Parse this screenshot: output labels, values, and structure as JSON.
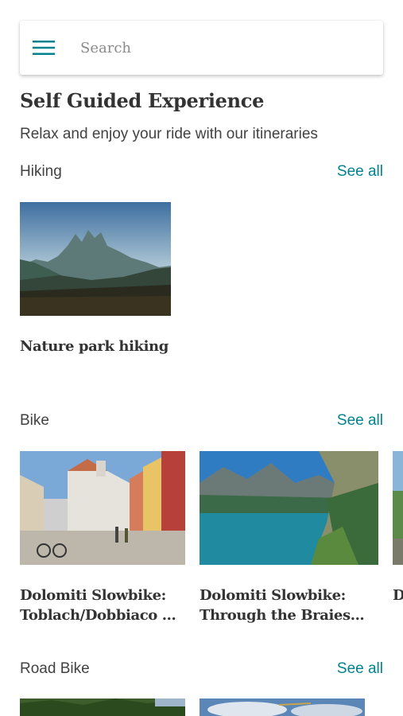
{
  "search": {
    "placeholder": "Search"
  },
  "header": {
    "title": "Self Guided Experience",
    "subtitle": "Relax and enjoy your ride with our itineraries"
  },
  "sections": [
    {
      "label": "Hiking",
      "see_all": "See all",
      "cards": [
        {
          "title": "Nature park hiking",
          "image": "mountain-dusk-landscape"
        }
      ]
    },
    {
      "label": "Bike",
      "see_all": "See all",
      "cards": [
        {
          "title": "Dolomiti Slowbike: Toblach/Dobbiaco ...",
          "image": "town-square-street"
        },
        {
          "title": "Dolomiti Slowbike: Through the Braies...",
          "image": "alpine-lake"
        },
        {
          "title": "D T",
          "image": "mountain-meadow"
        }
      ]
    },
    {
      "label": "Road Bike",
      "see_all": "See all",
      "cards": [
        {
          "title": "",
          "image": "forest-hills"
        },
        {
          "title": "",
          "image": "sky-clouds"
        }
      ]
    }
  ],
  "colors": {
    "accent": "#00838f",
    "menu_icon": "#00838f"
  }
}
